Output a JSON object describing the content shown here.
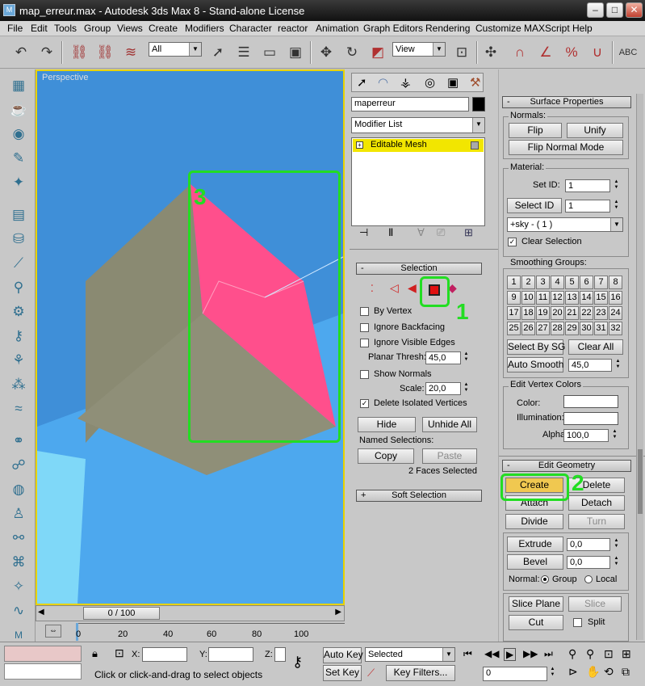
{
  "window": {
    "title": "map_erreur.max - Autodesk 3ds Max 8  - Stand-alone License",
    "minimize": "–",
    "maximize": "□",
    "close": "✕"
  },
  "menu": [
    "File",
    "Edit",
    "Tools",
    "Group",
    "Views",
    "Create",
    "Modifiers",
    "Character",
    "reactor",
    "Animation",
    "Graph Editors",
    "Rendering",
    "Customize",
    "MAXScript",
    "Help"
  ],
  "toolbar": {
    "filter_value": "All",
    "refcoord_value": "View",
    "undo_icon": "↶",
    "redo_icon": "↷"
  },
  "viewport": {
    "label": "Perspective",
    "frame_counter": "0 / 100"
  },
  "trackbar": {
    "ticks": [
      "0",
      "20",
      "40",
      "60",
      "80",
      "100"
    ]
  },
  "cmdpanel": {
    "object_name": "maperreur",
    "modifier_list": "Modifier List",
    "stack_item": "Editable Mesh",
    "selection": {
      "title": "Selection",
      "by_vertex": "By Vertex",
      "ignore_backfacing": "Ignore Backfacing",
      "ignore_visible_edges": "Ignore Visible Edges",
      "planar_thresh_label": "Planar Thresh:",
      "planar_thresh_value": "45,0",
      "show_normals": "Show Normals",
      "scale_label": "Scale:",
      "scale_value": "20,0",
      "delete_isolated": "Delete Isolated Vertices",
      "delete_isolated_check": "✓",
      "hide": "Hide",
      "unhide_all": "Unhide All",
      "named_selections": "Named Selections:",
      "copy": "Copy",
      "paste": "Paste",
      "status": "2 Faces Selected"
    },
    "soft_selection": "Soft Selection",
    "plus": "+",
    "minus": "-"
  },
  "surface": {
    "title": "Surface Properties",
    "normals_label": "Normals:",
    "flip": "Flip",
    "unify": "Unify",
    "flip_normal_mode": "Flip Normal Mode",
    "material_label": "Material:",
    "set_id_label": "Set ID:",
    "set_id_value": "1",
    "select_id": "Select ID",
    "select_id_value": "1",
    "material_combo": "+sky - ( 1 )",
    "clear_selection": "Clear Selection",
    "clear_selection_check": "✓",
    "smoothing_label": "Smoothing Groups:",
    "smoothing_groups": [
      "1",
      "2",
      "3",
      "4",
      "5",
      "6",
      "7",
      "8",
      "9",
      "10",
      "11",
      "12",
      "13",
      "14",
      "15",
      "16",
      "17",
      "18",
      "19",
      "20",
      "21",
      "22",
      "23",
      "24",
      "25",
      "26",
      "27",
      "28",
      "29",
      "30",
      "31",
      "32"
    ],
    "select_by_sg": "Select By SG",
    "clear_all": "Clear All",
    "auto_smooth": "Auto Smooth",
    "auto_smooth_value": "45,0",
    "vertex_colors_label": "Edit Vertex Colors",
    "color_label": "Color:",
    "illumination_label": "Illumination:",
    "alpha_label": "Alpha:",
    "alpha_value": "100,0"
  },
  "edit_geometry": {
    "title": "Edit Geometry",
    "create": "Create",
    "delete": "Delete",
    "attach": "Attach",
    "detach": "Detach",
    "divide": "Divide",
    "turn": "Turn",
    "extrude": "Extrude",
    "extrude_value": "0,0",
    "bevel": "Bevel",
    "bevel_value": "0,0",
    "normal_label": "Normal:",
    "group": "Group",
    "local": "Local",
    "slice_plane": "Slice Plane",
    "slice": "Slice",
    "cut": "Cut",
    "split": "Split"
  },
  "annotations": [
    "1",
    "2",
    "3"
  ],
  "status": {
    "x_label": "X:",
    "y_label": "Y:",
    "z_label": "Z:",
    "auto_key": "Auto Key",
    "set_key": "Set Key",
    "selected": "Selected",
    "key_filters": "Key Filters...",
    "frame": "0",
    "prompt": "Click or click-and-drag to select objects"
  }
}
